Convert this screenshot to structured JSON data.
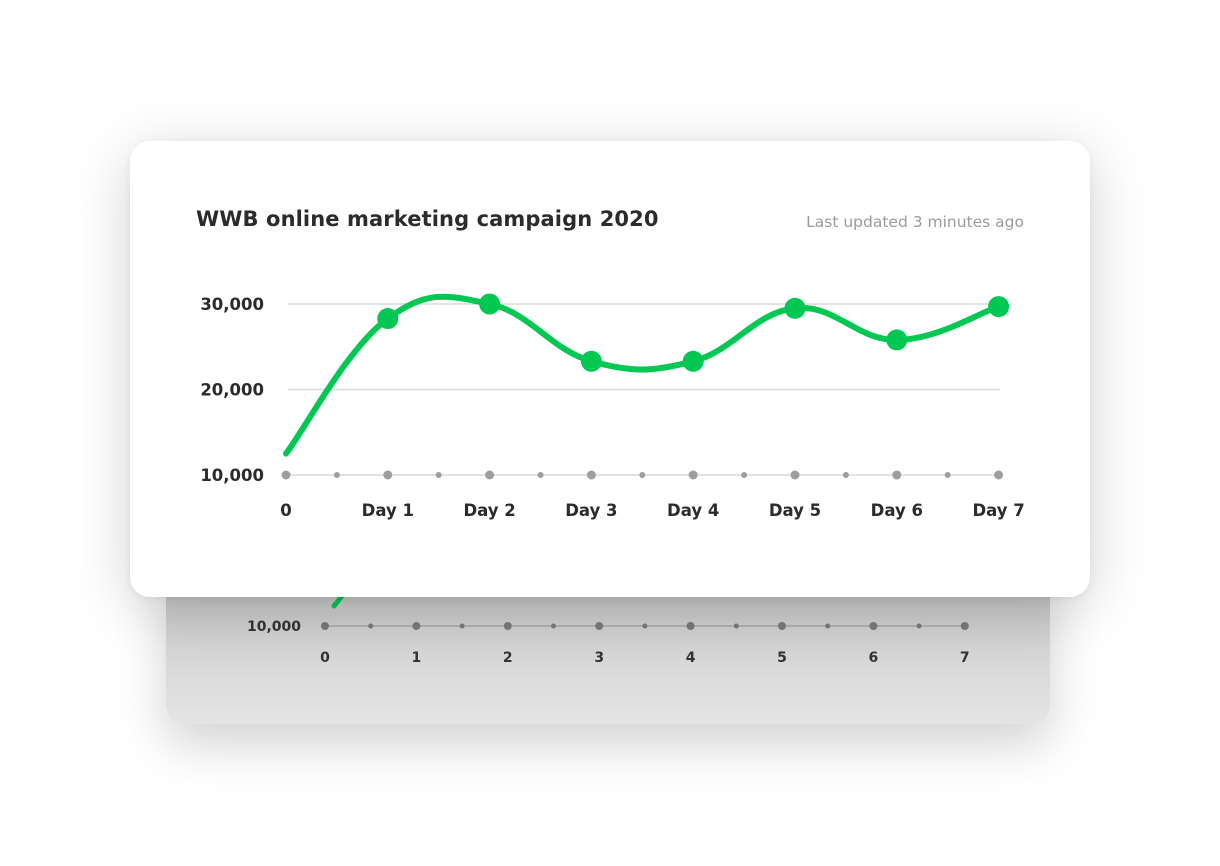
{
  "card": {
    "title": "WWB online marketing campaign 2020",
    "updated": "Last updated 3 minutes ago"
  },
  "colors": {
    "line": "#00c853",
    "grid": "#d9d9d9",
    "axis_dot": "#9e9e9e"
  },
  "chart_data": [
    {
      "type": "line",
      "title": "WWB online marketing campaign 2020",
      "xlabel": "",
      "ylabel": "",
      "x": [
        0,
        1,
        2,
        3,
        4,
        5,
        6,
        7
      ],
      "tick_labels": [
        "0",
        "Day 1",
        "Day 2",
        "Day 3",
        "Day 4",
        "Day 5",
        "Day 6",
        "Day 7"
      ],
      "y_ticks": [
        "10,000",
        "20,000",
        "30,000"
      ],
      "ylim": [
        10000,
        30000
      ],
      "series": [
        {
          "values": [
            12500,
            28300,
            30000,
            23300,
            23300,
            29500,
            25800,
            29700
          ]
        }
      ],
      "grid": true
    },
    {
      "type": "line",
      "x": [
        0,
        1,
        2,
        3,
        4,
        5,
        6,
        7
      ],
      "tick_labels": [
        "0",
        "1",
        "2",
        "3",
        "4",
        "5",
        "6",
        "7"
      ],
      "y_ticks": [
        "10,000"
      ],
      "series": [
        {
          "values": [
            11000
          ]
        }
      ]
    }
  ]
}
